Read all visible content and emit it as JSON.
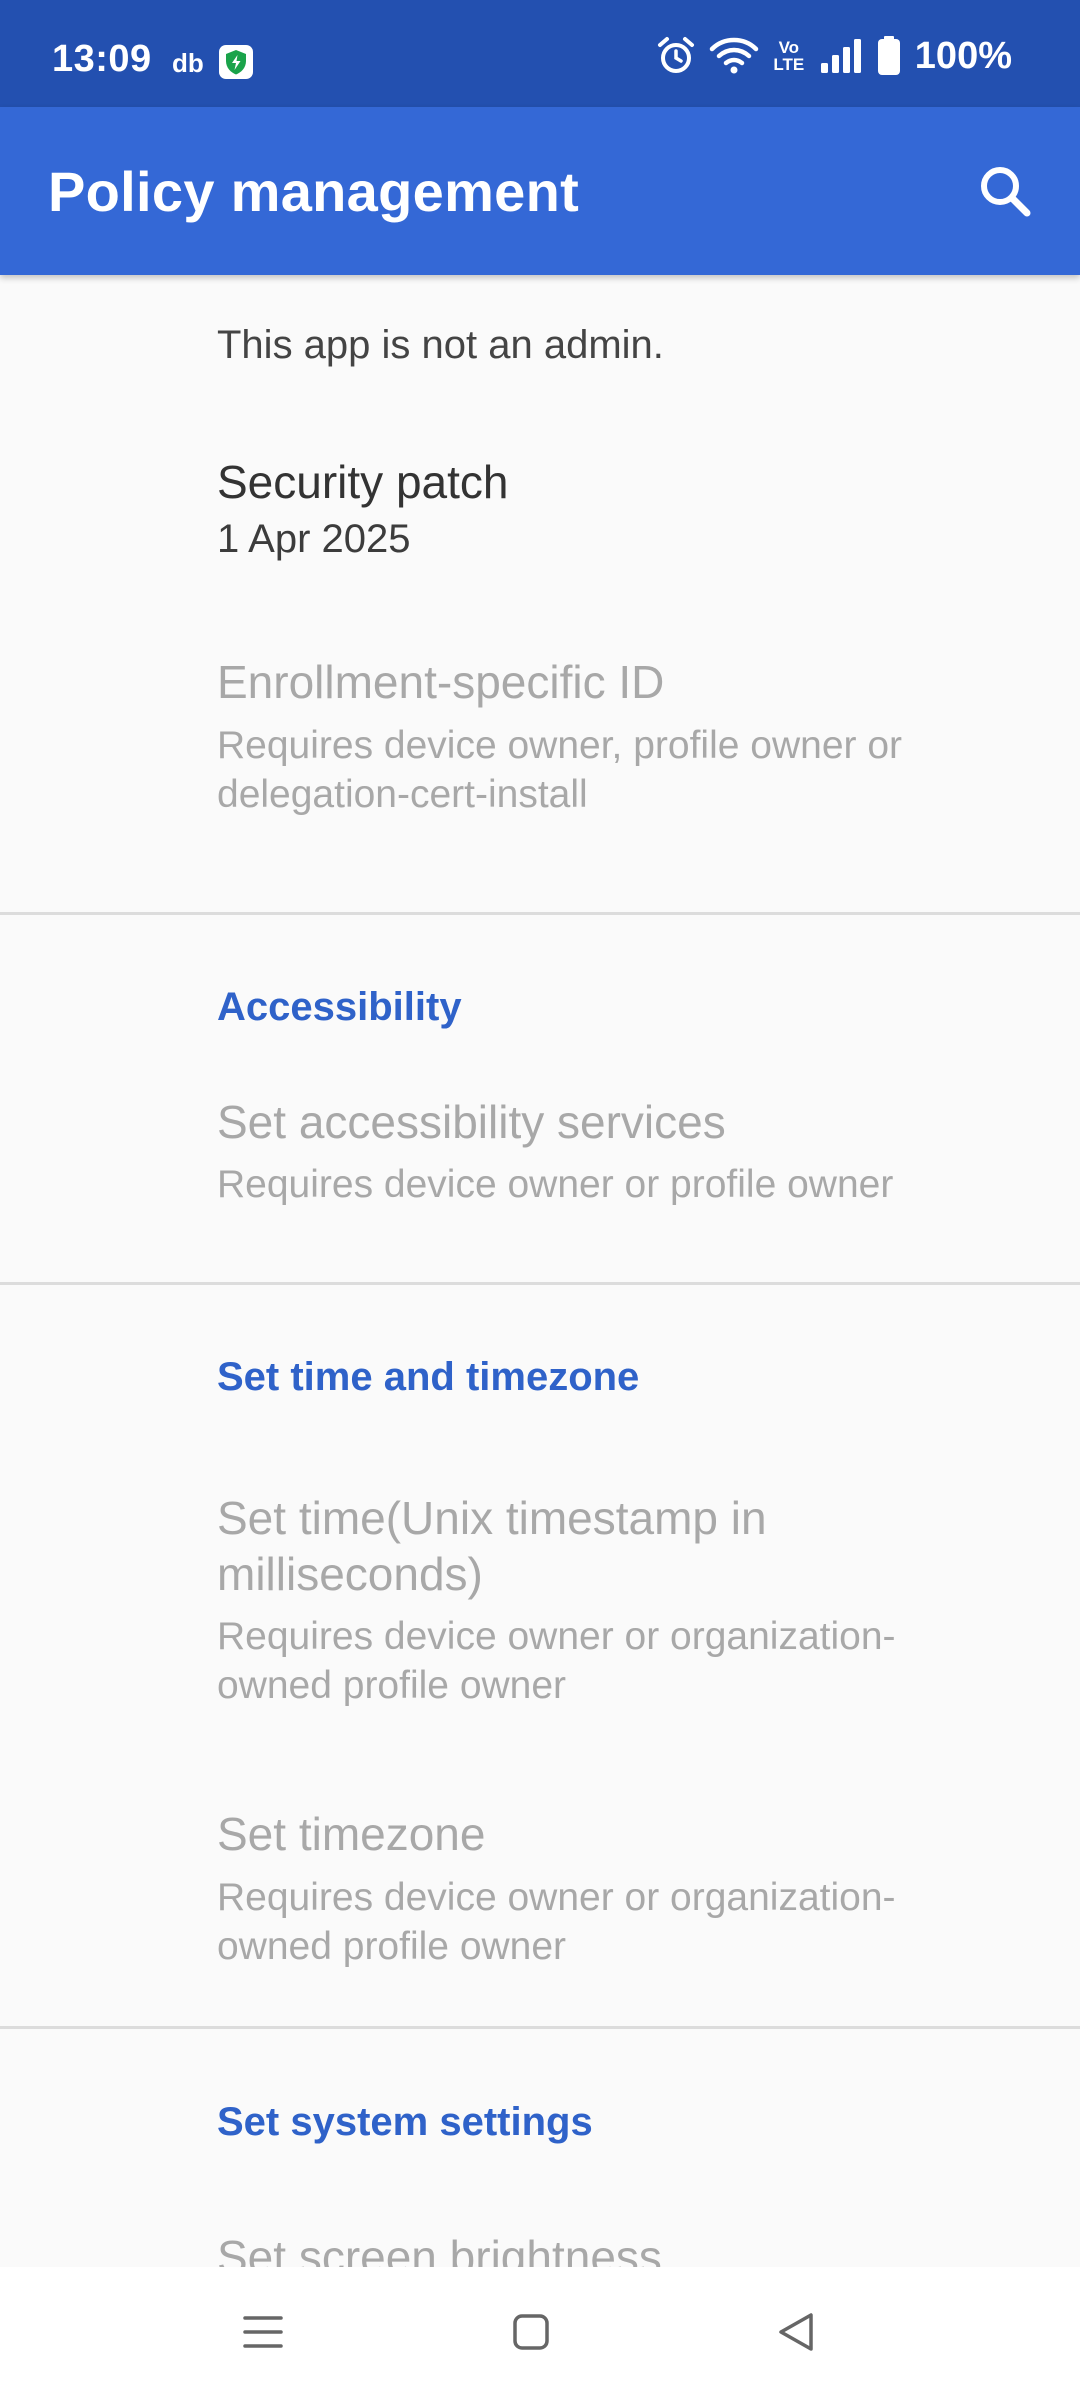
{
  "status_bar": {
    "time": "13:09",
    "db_label": "db",
    "volte_top": "Vo",
    "volte_bottom": "LTE",
    "battery_text": "100%",
    "icons": [
      "shield-icon",
      "alarm-icon",
      "wifi-icon",
      "volte-icon",
      "signal-icon",
      "battery-icon"
    ]
  },
  "app_bar": {
    "title": "Policy management",
    "search_icon": "search-icon"
  },
  "content": {
    "admin_message": "This app is not an admin.",
    "security_patch": {
      "title": "Security patch",
      "summary": "1 Apr 2025"
    },
    "enrollment_id": {
      "title": "Enrollment-specific ID",
      "summary": "Requires device owner, profile owner or delegation-cert-install"
    },
    "categories": {
      "accessibility": {
        "title": "Accessibility",
        "items": [
          {
            "title": "Set accessibility services",
            "summary": "Requires device owner or profile owner"
          }
        ]
      },
      "time_timezone": {
        "title": "Set time and timezone",
        "items": [
          {
            "title": "Set time(Unix timestamp in milliseconds)",
            "summary": "Requires device owner or organization-owned profile owner"
          },
          {
            "title": "Set timezone",
            "summary": "Requires device owner or organization-owned profile owner"
          }
        ]
      },
      "system_settings": {
        "title": "Set system settings",
        "items": [
          {
            "title": "Set screen brightness"
          }
        ]
      }
    }
  },
  "nav_bar": {
    "icons": [
      "menu-icon",
      "home-icon",
      "back-icon"
    ]
  },
  "colors": {
    "status_bar": "#2350b0",
    "app_bar": "#3468d6",
    "accent": "#2f62c9",
    "background": "#fafafa",
    "disabled_text": "#a8a8a8"
  }
}
